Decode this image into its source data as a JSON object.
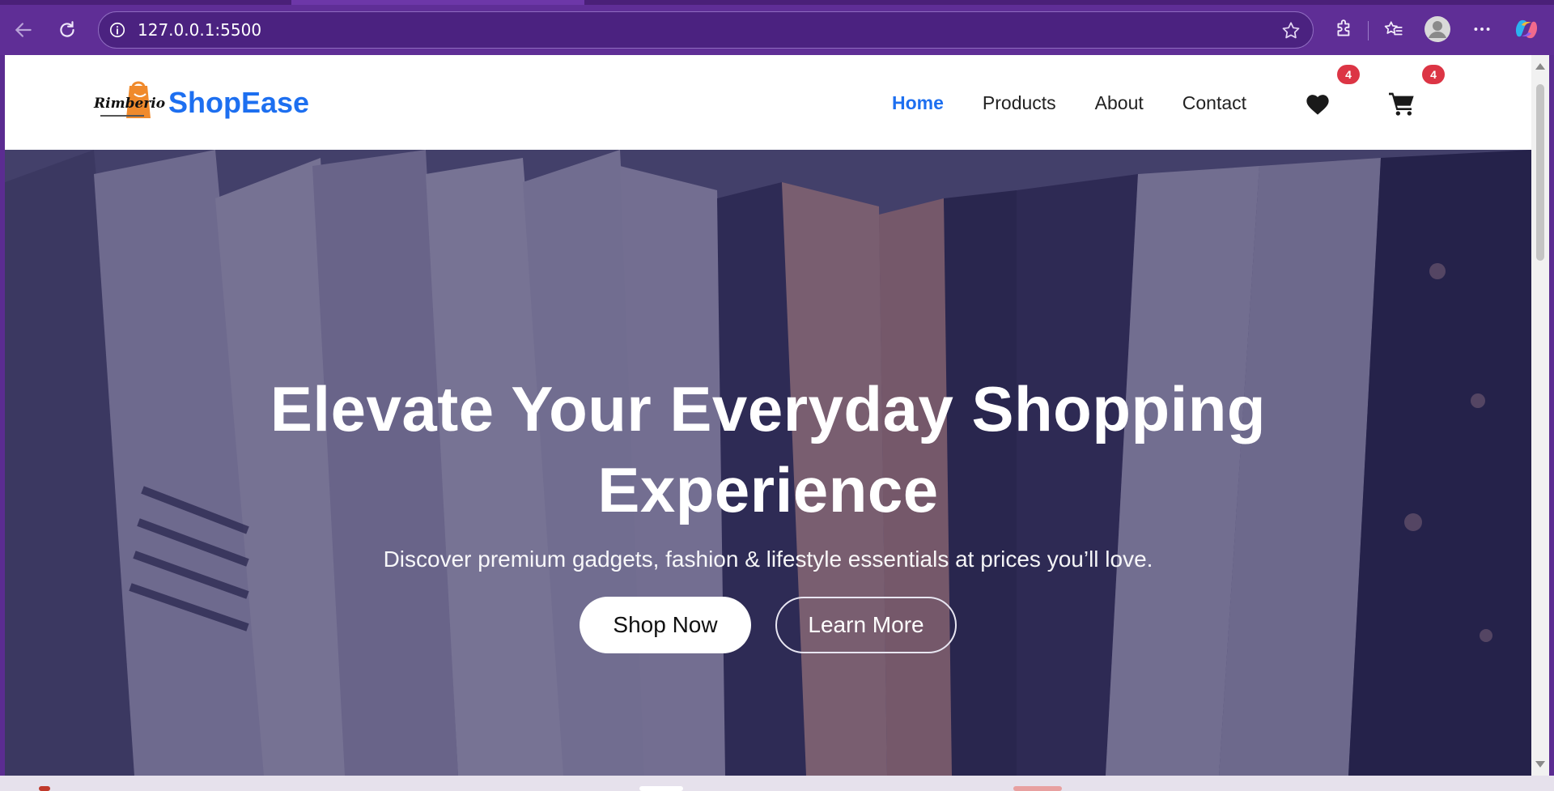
{
  "browser": {
    "url": "127.0.0.1:5500",
    "accent": "#5f2e96"
  },
  "site": {
    "brand": "ShopEase",
    "logo_text": "Rimberio",
    "nav": [
      {
        "label": "Home",
        "active": true
      },
      {
        "label": "Products",
        "active": false
      },
      {
        "label": "About",
        "active": false
      },
      {
        "label": "Contact",
        "active": false
      }
    ],
    "wishlist_count": "4",
    "cart_count": "4",
    "accent": "#1d6ff0",
    "badge_color": "#dc3545"
  },
  "hero": {
    "title_line1": "Elevate Your Everyday Shopping",
    "title_line2": "Experience",
    "subtitle": "Discover premium gadgets, fashion & lifestyle essentials at prices you’ll love.",
    "primary_button": "Shop Now",
    "secondary_button": "Learn More"
  }
}
